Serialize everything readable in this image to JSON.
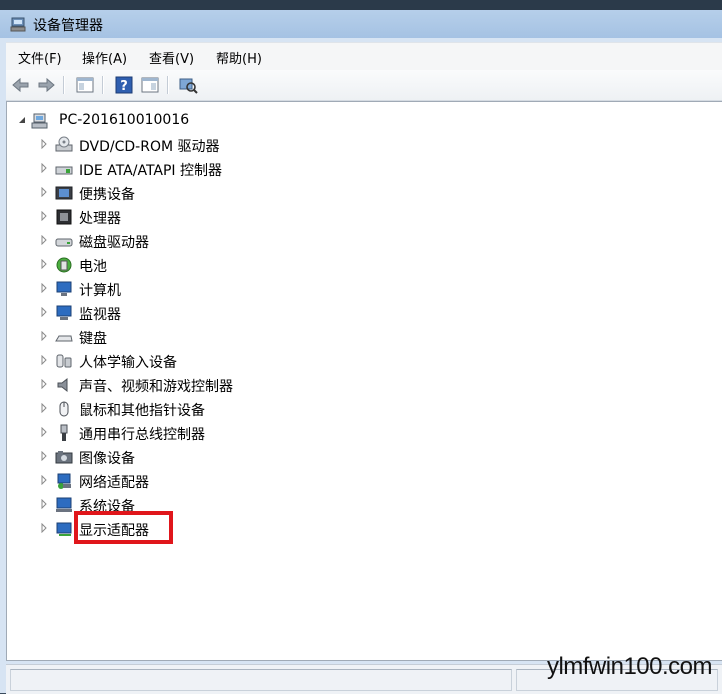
{
  "window": {
    "title": "设备管理器"
  },
  "menu": [
    {
      "label": "文件(F)"
    },
    {
      "label": "操作(A)"
    },
    {
      "label": "查看(V)"
    },
    {
      "label": "帮助(H)"
    }
  ],
  "toolbar": {
    "icons": [
      "back-arrow-icon",
      "forward-arrow-icon",
      "properties-pane-icon",
      "help-icon",
      "show-hide-icon",
      "scan-hardware-icon"
    ]
  },
  "tree": {
    "root": {
      "label": "PC-201610010016",
      "icon": "computer-root-icon"
    },
    "items": [
      {
        "label": "DVD/CD-ROM 驱动器",
        "icon": "dvd-drive-icon"
      },
      {
        "label": "IDE ATA/ATAPI 控制器",
        "icon": "ide-controller-icon"
      },
      {
        "label": "便携设备",
        "icon": "portable-device-icon"
      },
      {
        "label": "处理器",
        "icon": "processor-icon"
      },
      {
        "label": "磁盘驱动器",
        "icon": "disk-drive-icon"
      },
      {
        "label": "电池",
        "icon": "battery-icon"
      },
      {
        "label": "计算机",
        "icon": "computer-icon"
      },
      {
        "label": "监视器",
        "icon": "monitor-icon"
      },
      {
        "label": "键盘",
        "icon": "keyboard-icon"
      },
      {
        "label": "人体学输入设备",
        "icon": "hid-icon"
      },
      {
        "label": "声音、视频和游戏控制器",
        "icon": "speaker-icon"
      },
      {
        "label": "鼠标和其他指针设备",
        "icon": "mouse-icon"
      },
      {
        "label": "通用串行总线控制器",
        "icon": "usb-icon"
      },
      {
        "label": "图像设备",
        "icon": "camera-icon"
      },
      {
        "label": "网络适配器",
        "icon": "network-adapter-icon"
      },
      {
        "label": "系统设备",
        "icon": "system-device-icon"
      },
      {
        "label": "显示适配器",
        "icon": "display-adapter-icon"
      }
    ]
  },
  "watermark": "ylmfwin100.com",
  "colors": {
    "highlight": "#e0161b",
    "title_bg": "#a9c4e3"
  }
}
